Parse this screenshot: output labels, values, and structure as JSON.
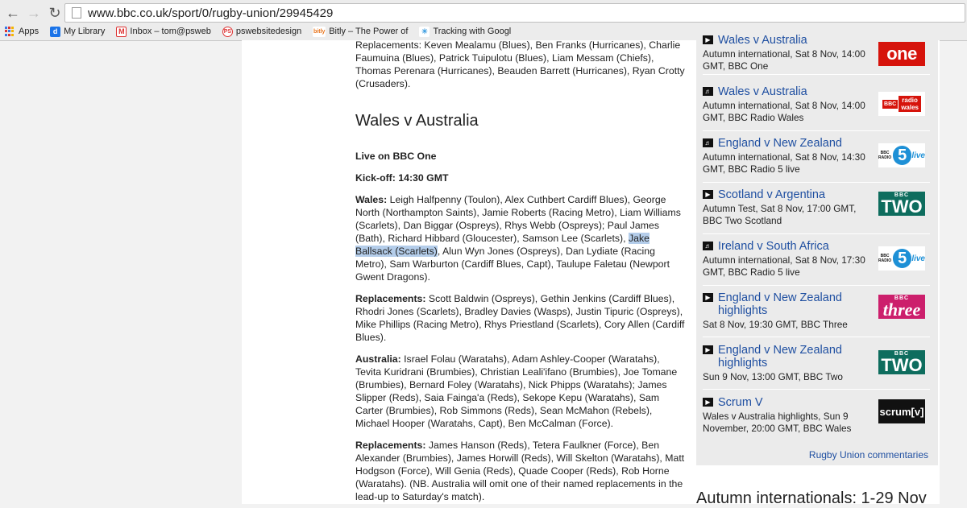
{
  "browser": {
    "url": "www.bbc.co.uk/sport/0/rugby-union/29945429",
    "bookmarks": [
      {
        "label": "Apps",
        "icon": "apps-grid-icon"
      },
      {
        "label": "My Library",
        "icon": "delicious-icon"
      },
      {
        "label": "Inbox – tom@psweb",
        "icon": "gmail-icon"
      },
      {
        "label": "pswebsitedesign",
        "icon": "psweb-icon"
      },
      {
        "label": "Bitly – The Power of",
        "icon": "bitly-icon"
      },
      {
        "label": "Tracking with Googl",
        "icon": "tracking-icon"
      }
    ]
  },
  "article": {
    "top_replacements": "Replacements: Keven Mealamu (Blues), Ben Franks (Hurricanes), Charlie Faumuina (Blues), Patrick Tuipulotu (Blues), Liam Messam (Chiefs), Thomas Perenara (Hurricanes), Beauden Barrett (Hurricanes), Ryan Crotty (Crusaders).",
    "heading": "Wales v Australia",
    "live": "Live on BBC One",
    "kickoff": "Kick-off: 14:30 GMT",
    "wales_label": "Wales:",
    "wales_before": " Leigh Halfpenny (Toulon), Alex Cuthbert Cardiff Blues), George North (Northampton Saints), Jamie Roberts (Racing Metro), Liam Williams (Scarlets), Dan Biggar (Ospreys), Rhys Webb (Ospreys); Paul James (Bath), Richard Hibbard (Gloucester), Samson Lee (Scarlets), ",
    "wales_highlight": "Jake Ballsack (Scarlets)",
    "wales_after": ", Alun Wyn Jones (Ospreys), Dan Lydiate (Racing Metro), Sam Warburton (Cardiff Blues, Capt), Taulupe Faletau (Newport Gwent Dragons).",
    "wales_rep_label": "Replacements:",
    "wales_rep": " Scott Baldwin (Ospreys), Gethin Jenkins (Cardiff Blues), Rhodri Jones (Scarlets), Bradley Davies (Wasps), Justin Tipuric (Ospreys), Mike Phillips (Racing Metro), Rhys Priestland (Scarlets), Cory Allen (Cardiff Blues).",
    "aus_label": "Australia:",
    "aus": " Israel Folau (Waratahs), Adam Ashley-Cooper (Waratahs), Tevita Kuridrani (Brumbies), Christian Leali'ifano (Brumbies), Joe Tomane (Brumbies), Bernard Foley (Waratahs), Nick Phipps (Waratahs); James Slipper (Reds), Saia Fainga'a (Reds), Sekope Kepu (Waratahs), Sam Carter (Brumbies), Rob Simmons (Reds), Sean McMahon (Rebels), Michael Hooper (Waratahs, Capt), Ben McCalman (Force).",
    "aus_rep_label": "Replacements:",
    "aus_rep": " James Hanson (Reds), Tetera Faulkner (Force), Ben Alexander (Brumbies), James Horwill (Reds), Will Skelton (Waratahs), Matt Hodgson (Force), Will Genia (Reds), Quade Cooper (Reds), Rob Horne (Waratahs). (NB. Australia will omit one of their named replacements in the lead-up to Saturday's match)."
  },
  "sidebar": {
    "items": [
      {
        "title": "Wales v Australia",
        "desc": "Autumn international, Sat 8 Nov, 14:00 GMT, BBC One",
        "icon": "video-icon",
        "logo": "one"
      },
      {
        "title": "Wales v Australia",
        "desc": "Autumn international, Sat 8 Nov, 14:00 GMT, BBC Radio Wales",
        "icon": "audio-icon",
        "logo": "BBC radio wales"
      },
      {
        "title": "England v New Zealand",
        "desc": "Autumn international, Sat 8 Nov, 14:30 GMT, BBC Radio 5 live",
        "icon": "audio-icon",
        "logo": "5 live"
      },
      {
        "title": "Scotland v Argentina",
        "desc": "Autumn Test, Sat 8 Nov, 17:00 GMT, BBC Two Scotland",
        "icon": "video-icon",
        "logo": "TWO"
      },
      {
        "title": "Ireland v South Africa",
        "desc": "Autumn international, Sat 8 Nov, 17:30 GMT, BBC Radio 5 live",
        "icon": "audio-icon",
        "logo": "5 live"
      },
      {
        "title": "England v New Zealand highlights",
        "desc": "Sat 8 Nov, 19:30 GMT, BBC Three",
        "icon": "video-icon",
        "logo": "three"
      },
      {
        "title": "England v New Zealand highlights",
        "desc": "Sun 9 Nov, 13:00 GMT, BBC Two",
        "icon": "video-icon",
        "logo": "TWO"
      },
      {
        "title": "Scrum V",
        "desc": "Wales v Australia highlights, Sun 9 November, 20:00 GMT, BBC Wales",
        "icon": "video-icon",
        "logo": "scrum[v]"
      }
    ],
    "commentaries_link": "Rugby Union commentaries",
    "bbc_small": "BBC",
    "radio_small": "RADIO",
    "radio_word": "radio",
    "wales_word": "wales",
    "five_digit": "5",
    "live_word": "live"
  },
  "autumn_heading": "Autumn internationals: 1-29 Nov",
  "colors": {
    "link": "#1f4fa1",
    "highlight": "#b4cdea",
    "bbc_one": "#d6130b",
    "bbc_two": "#0e6d5e",
    "bbc_three": "#cc1f6c"
  }
}
